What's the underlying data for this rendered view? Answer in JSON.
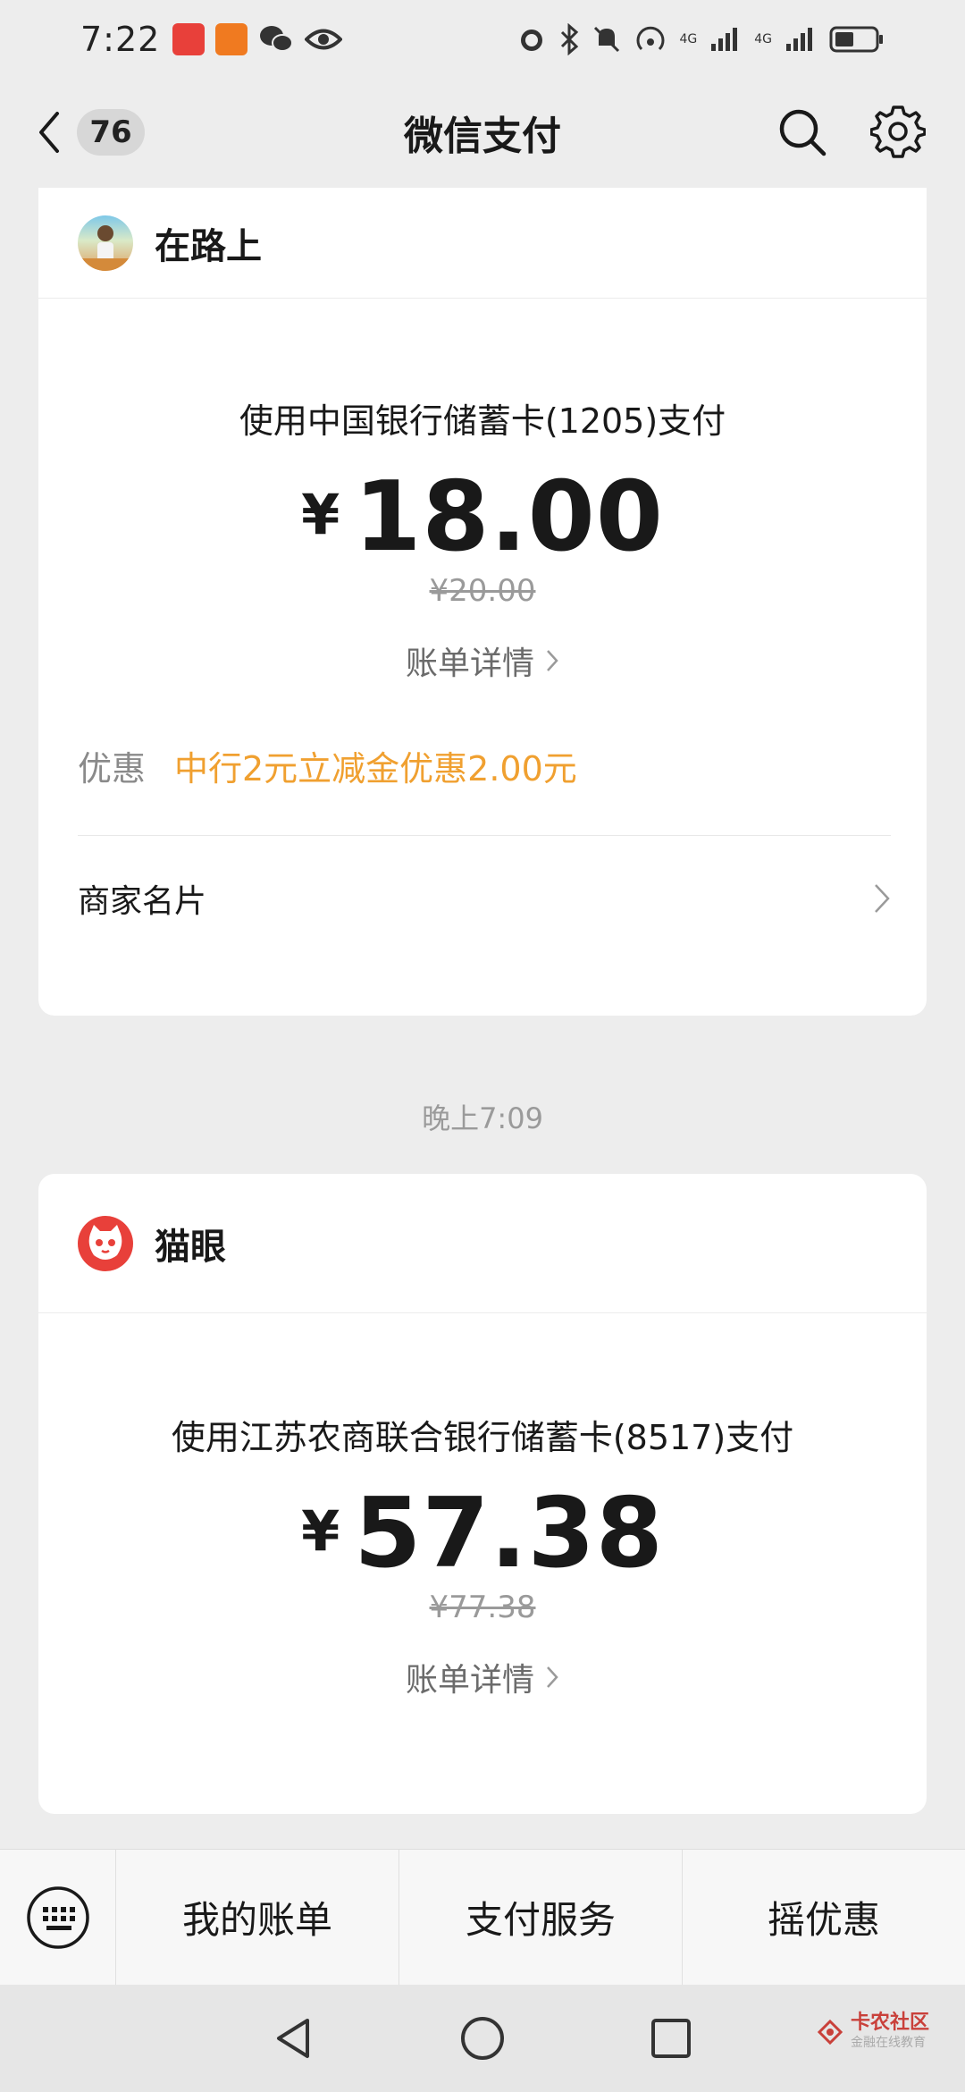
{
  "status_bar": {
    "time": "7:22",
    "network_labels": [
      "4G",
      "4G"
    ]
  },
  "header": {
    "back_label": "返回",
    "unread_count": "76",
    "title": "微信支付"
  },
  "cards": [
    {
      "merchant": "在路上",
      "pay_method": "使用中国银行储蓄卡(1205)支付",
      "currency": "¥",
      "amount": "18.00",
      "original_amount": "¥20.00",
      "bill_detail": "账单详情",
      "discount_label": "优惠",
      "discount_text": "中行2元立减金优惠2.00元",
      "merchant_card": "商家名片"
    },
    {
      "merchant": "猫眼",
      "pay_method": "使用江苏农商联合银行储蓄卡(8517)支付",
      "currency": "¥",
      "amount": "57.38",
      "original_amount": "¥77.38",
      "bill_detail": "账单详情"
    }
  ],
  "time_separator": "晚上7:09",
  "bottom_menu": {
    "items": [
      "我的账单",
      "支付服务",
      "摇优惠"
    ]
  },
  "watermark": {
    "title": "卡农社区",
    "subtitle": "金融在线教育"
  },
  "colors": {
    "discount": "#f0a030",
    "maoyan": "#e8403a",
    "background": "#ededed"
  }
}
